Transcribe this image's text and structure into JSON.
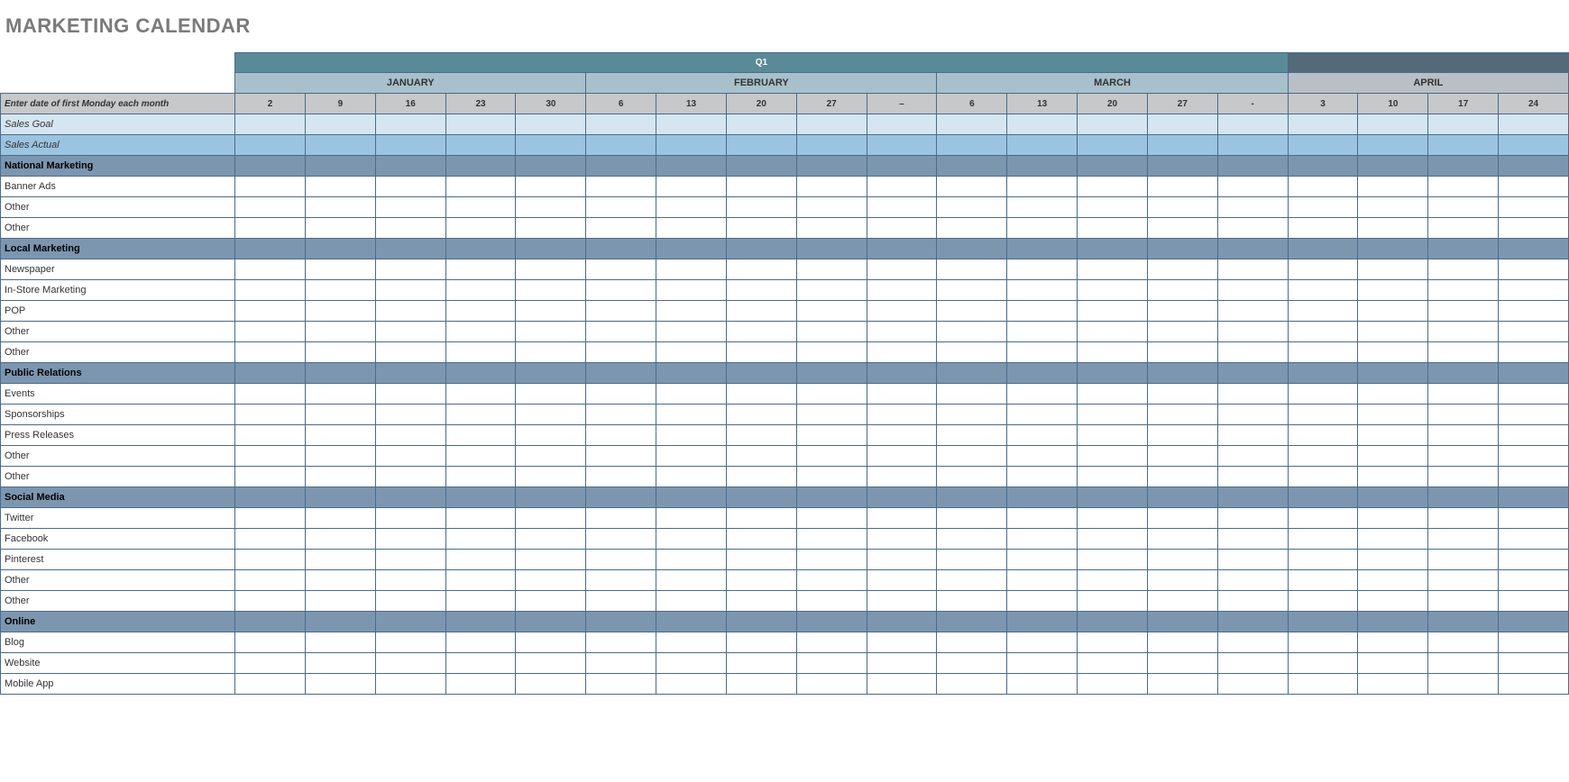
{
  "title": "MARKETING CALENDAR",
  "quarter": "Q1",
  "months": [
    "JANUARY",
    "FEBRUARY",
    "MARCH",
    "APRIL"
  ],
  "weeks": {
    "jan": [
      "2",
      "9",
      "16",
      "23",
      "30"
    ],
    "feb": [
      "6",
      "13",
      "20",
      "27",
      "–"
    ],
    "mar": [
      "6",
      "13",
      "20",
      "27",
      "-"
    ],
    "apr": [
      "3",
      "10",
      "17",
      "24"
    ]
  },
  "labels": {
    "instr": "Enter date of first Monday each month",
    "goal": "Sales Goal",
    "actual": "Sales Actual"
  },
  "sections": [
    {
      "name": "National Marketing",
      "items": [
        "Banner Ads",
        "Other",
        "Other"
      ]
    },
    {
      "name": "Local Marketing",
      "items": [
        "Newspaper",
        "In-Store Marketing",
        "POP",
        "Other",
        "Other"
      ]
    },
    {
      "name": "Public Relations",
      "items": [
        "Events",
        "Sponsorships",
        "Press Releases",
        "Other",
        "Other"
      ]
    },
    {
      "name": "Social Media",
      "items": [
        "Twitter",
        "Facebook",
        "Pinterest",
        "Other",
        "Other"
      ]
    },
    {
      "name": "Online",
      "items": [
        "Blog",
        "Website",
        "Mobile App"
      ]
    }
  ]
}
